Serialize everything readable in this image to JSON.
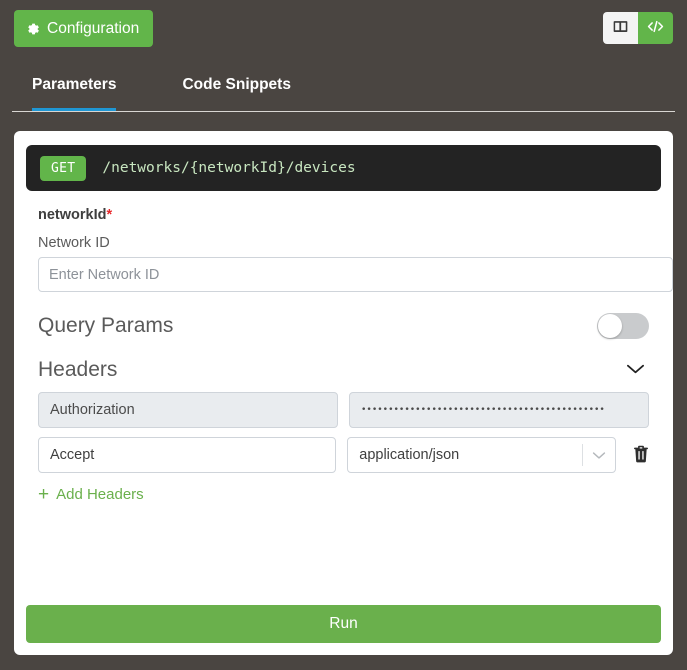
{
  "theme": {
    "background": "#4a4541",
    "green": "#62b54a",
    "run_green": "#6ab04c",
    "tab_underline_blue": "#1f97d4",
    "code_bg": "#232323",
    "required_red": "#e8282b"
  },
  "topbar": {
    "config_button": {
      "label": "Configuration",
      "icon": "gear-icon"
    },
    "view_toggle": {
      "split_view": {
        "icon": "panel-layout-icon",
        "active": false
      },
      "code_view": {
        "icon": "code-brackets-icon",
        "active": true
      }
    }
  },
  "tabs": [
    {
      "label": "Parameters",
      "active": true
    },
    {
      "label": "Code Snippets",
      "active": false
    }
  ],
  "endpoint": {
    "method": "GET",
    "path": "/networks/{networkId}/devices"
  },
  "path_param": {
    "name": "networkId",
    "required_marker": "*",
    "label": "Network ID",
    "placeholder": "Enter Network ID",
    "value": ""
  },
  "query_params": {
    "title": "Query Params",
    "toggle_on": false
  },
  "headers": {
    "title": "Headers",
    "expanded": true,
    "chevron_icon": "chevron-down-icon",
    "rows": [
      {
        "key": "Authorization",
        "key_locked": true,
        "value_type": "password",
        "value_masked": "•••••••••••••••••••••••••••••••••••••••••••••",
        "value_locked": true,
        "deletable": false
      },
      {
        "key": "Accept",
        "key_locked": false,
        "value_type": "select",
        "value": "application/json",
        "value_locked": false,
        "deletable": true,
        "delete_icon": "trash-icon",
        "dropdown_icon": "chevron-down-icon"
      }
    ],
    "add_link": {
      "label": "Add Headers",
      "icon": "plus-icon"
    }
  },
  "footer": {
    "run_label": "Run"
  }
}
